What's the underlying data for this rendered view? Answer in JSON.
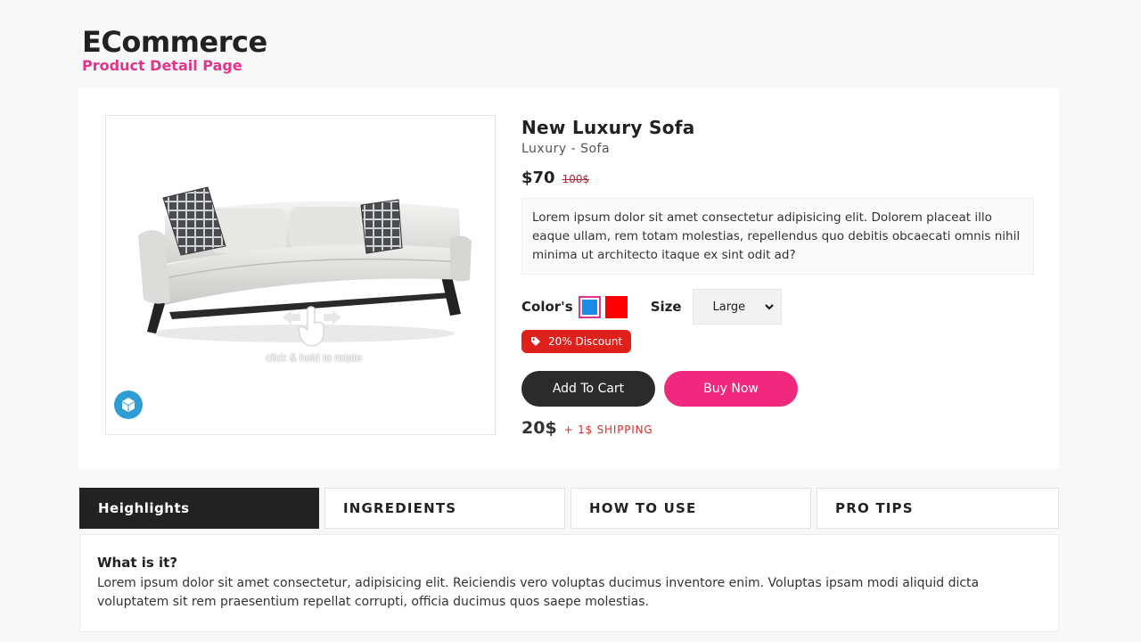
{
  "header": {
    "title": "ECommerce",
    "subtitle": "Product Detail Page"
  },
  "viewer": {
    "hint": "click & hold to rotate",
    "icons": [
      "sofa-3d-model",
      "hand-drag-icon",
      "3d-cube-icon"
    ]
  },
  "product": {
    "title": "New Luxury Sofa",
    "category": "Luxury - Sofa",
    "price": "$70",
    "old_price": "100$",
    "description": "Lorem ipsum dolor sit amet consectetur adipisicing elit. Dolorem placeat illo eaque ullam, rem totam molestias, repellendus quo debitis obcaecati omnis nihil minima ut architecto itaque ex sint odit ad?",
    "colors_label": "Color's",
    "colors": [
      "#1a8ce8",
      "#ff0000"
    ],
    "selected_color": "#1a8ce8",
    "size_label": "Size",
    "size_value": "Large",
    "discount": "20% Discount",
    "add_to_cart": "Add To Cart",
    "buy_now": "Buy Now",
    "shipping_amount": "20$",
    "shipping_note": "+ 1$ SHIPPING"
  },
  "tabs": [
    {
      "label": "Heighlights",
      "active": true
    },
    {
      "label": "INGREDIENTS",
      "active": false
    },
    {
      "label": "HOW TO USE",
      "active": false
    },
    {
      "label": "PRO TIPS",
      "active": false
    }
  ],
  "panel": {
    "question": "What is it?",
    "answer": "Lorem ipsum dolor sit amet consectetur, adipisicing elit. Reiciendis vero voluptas ducimus inventore enim. Voluptas ipsam modi aliquid dicta voluptatem sit rem praesentium repellat corrupti, officia ducimus quos saepe molestias."
  },
  "colors": {
    "accent": "#e0358a",
    "buy_button": "#f0287e",
    "cart_button": "#2b2b2b",
    "discount_badge": "#e0201a",
    "cube_button": "#2d9dd4"
  }
}
